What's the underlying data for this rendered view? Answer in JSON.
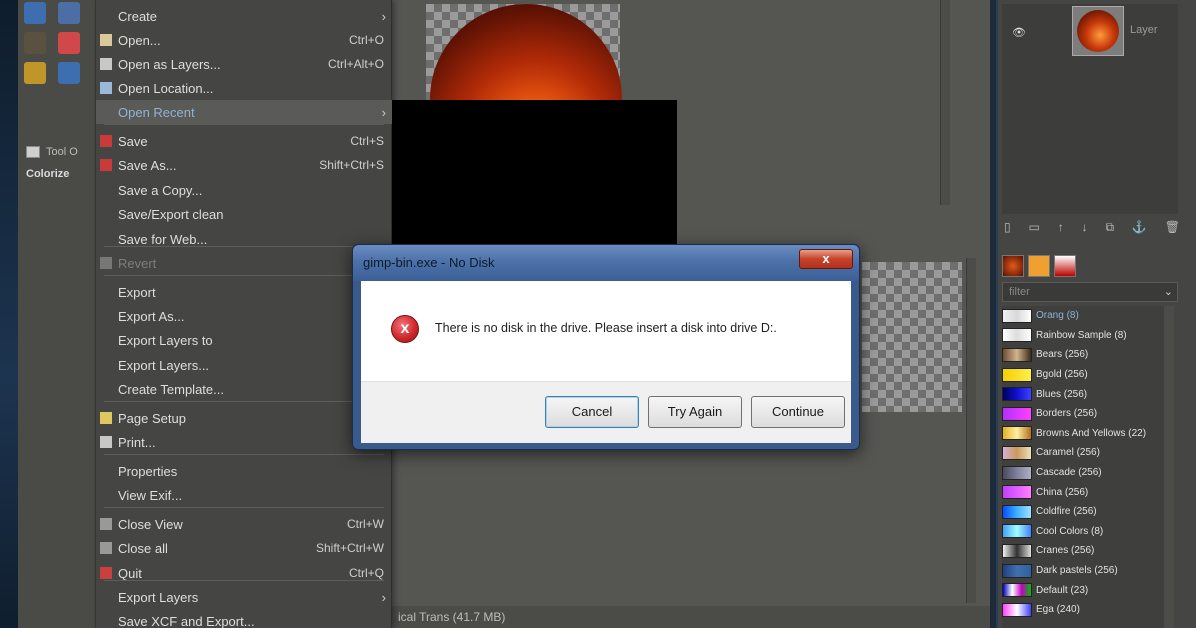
{
  "file_menu": {
    "items": [
      {
        "label": "Create",
        "accel": "",
        "submenu": true,
        "icon": ""
      },
      {
        "label": "Open...",
        "accel": "Ctrl+O",
        "submenu": false,
        "icon": "folder-icon"
      },
      {
        "label": "Open as Layers...",
        "accel": "Ctrl+Alt+O",
        "submenu": false,
        "icon": "layers-open-icon"
      },
      {
        "label": "Open Location...",
        "accel": "",
        "submenu": false,
        "icon": "globe-icon"
      },
      {
        "label": "Open Recent",
        "accel": "",
        "submenu": true,
        "icon": ""
      },
      {
        "label": "Save",
        "accel": "Ctrl+S",
        "submenu": false,
        "icon": "save-icon"
      },
      {
        "label": "Save As...",
        "accel": "Shift+Ctrl+S",
        "submenu": false,
        "icon": "save-as-icon"
      },
      {
        "label": "Save a Copy...",
        "accel": "",
        "submenu": false,
        "icon": ""
      },
      {
        "label": "Save/Export clean",
        "accel": "",
        "submenu": false,
        "icon": ""
      },
      {
        "label": "Save for Web...",
        "accel": "",
        "submenu": false,
        "icon": ""
      },
      {
        "label": "Revert",
        "accel": "",
        "submenu": false,
        "icon": "revert-icon"
      },
      {
        "label": "Export",
        "accel": "C",
        "submenu": false,
        "icon": ""
      },
      {
        "label": "Export As...",
        "accel": "Shift+",
        "submenu": false,
        "icon": ""
      },
      {
        "label": "Export Layers to",
        "accel": "",
        "submenu": false,
        "icon": ""
      },
      {
        "label": "Export Layers...",
        "accel": "",
        "submenu": false,
        "icon": ""
      },
      {
        "label": "Create Template...",
        "accel": "",
        "submenu": false,
        "icon": ""
      },
      {
        "label": "Page Setup",
        "accel": "",
        "submenu": false,
        "icon": "page-setup-icon"
      },
      {
        "label": "Print...",
        "accel": "C",
        "submenu": false,
        "icon": "print-icon"
      },
      {
        "label": "Properties",
        "accel": "",
        "submenu": false,
        "icon": ""
      },
      {
        "label": "View Exif...",
        "accel": "",
        "submenu": false,
        "icon": ""
      },
      {
        "label": "Close View",
        "accel": "Ctrl+W",
        "submenu": false,
        "icon": "close-icon"
      },
      {
        "label": "Close all",
        "accel": "Shift+Ctrl+W",
        "submenu": false,
        "icon": "close-icon"
      },
      {
        "label": "Quit",
        "accel": "Ctrl+Q",
        "submenu": false,
        "icon": "quit-icon"
      },
      {
        "label": "Export Layers",
        "accel": "",
        "submenu": true,
        "icon": ""
      },
      {
        "label": "Save XCF and Export...",
        "accel": "",
        "submenu": false,
        "icon": ""
      }
    ]
  },
  "toolbox": {
    "tool_options_tab": "Tool O",
    "tool_options_label": "Colorize"
  },
  "dialog": {
    "title": "gimp-bin.exe - No Disk",
    "close_label": "x",
    "message": "There is no disk in the drive. Please insert a disk into drive D:.",
    "buttons": {
      "cancel": "Cancel",
      "try_again": "Try Again",
      "continue": "Continue"
    },
    "error_icon_glyph": "x"
  },
  "status_bar": {
    "text": "ical Trans (41.7 MB)"
  },
  "layers_panel": {
    "layer_name": "Layer"
  },
  "gradients": {
    "filter_placeholder": "filter",
    "items": [
      {
        "label": "Orang (8)",
        "swatch": "linear-gradient(90deg,#f0f0f0,#d8d8d8,#ffffff)",
        "selected": true
      },
      {
        "label": "Rainbow Sample (8)",
        "swatch": "linear-gradient(90deg,#fff,#ddd,#fff)",
        "selected": false
      },
      {
        "label": "Bears (256)",
        "swatch": "linear-gradient(90deg,#6e4d35,#d2b48c,#3b2a1a)",
        "selected": false
      },
      {
        "label": "Bgold (256)",
        "swatch": "linear-gradient(90deg,#f3d000,#ffef4a)",
        "selected": false
      },
      {
        "label": "Blues (256)",
        "swatch": "linear-gradient(90deg,#000060,#1010d0,#4040ff)",
        "selected": false
      },
      {
        "label": "Borders (256)",
        "swatch": "linear-gradient(90deg,#b030ff,#ff40ff)",
        "selected": false
      },
      {
        "label": "Browns And Yellows (22)",
        "swatch": "linear-gradient(90deg,#e7b022,#fff0a0,#b07020)",
        "selected": false
      },
      {
        "label": "Caramel (256)",
        "swatch": "linear-gradient(90deg,#d8b0d8,#c89a5a,#f0e0c0)",
        "selected": false
      },
      {
        "label": "Cascade (256)",
        "swatch": "linear-gradient(90deg,#4a4a5a,#8080a0,#b0b0c0)",
        "selected": false
      },
      {
        "label": "China (256)",
        "swatch": "linear-gradient(90deg,#c040ff,#ff80ff)",
        "selected": false
      },
      {
        "label": "Coldfire (256)",
        "swatch": "linear-gradient(90deg,#0050ff,#40b0ff,#a0e0ff)",
        "selected": false
      },
      {
        "label": "Cool Colors (8)",
        "swatch": "linear-gradient(90deg,#40a0ff,#a0ffff,#4080ff)",
        "selected": false
      },
      {
        "label": "Cranes (256)",
        "swatch": "linear-gradient(90deg,#f0f0f0,#303030,#e0e0e0)",
        "selected": false
      },
      {
        "label": "Dark pastels (256)",
        "swatch": "linear-gradient(90deg,#204080,#4070b0,#3060a0)",
        "selected": false
      },
      {
        "label": "Default (23)",
        "swatch": "linear-gradient(90deg,#0000c0,#ffffff,#c000c0,#00c000)",
        "selected": false
      },
      {
        "label": "Ega (240)",
        "swatch": "linear-gradient(90deg,#ff40ff,#ffffff,#4040ff)",
        "selected": false
      }
    ]
  },
  "colors": {
    "menu_bg": "#454543",
    "menu_highlight": "#5a5a57",
    "dialog_frame": "#3a5a8c",
    "error_red": "#cf2a2e"
  }
}
